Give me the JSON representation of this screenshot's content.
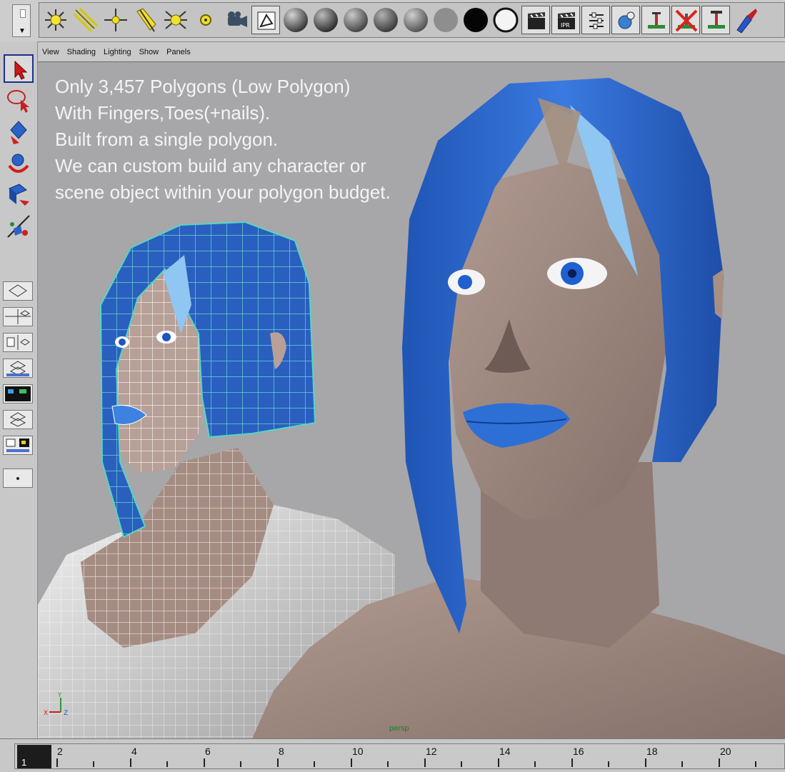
{
  "shelf": {
    "icons": [
      "ambient-light-icon",
      "directional-light-icon",
      "point-light-icon",
      "spot-light-icon",
      "area-light-icon",
      "volume-light-icon",
      "camera-icon",
      "render-layer-icon",
      "shader-sphere-1-icon",
      "shader-sphere-2-icon",
      "shader-sphere-3-icon",
      "shader-sphere-4-icon",
      "shader-sphere-5-icon",
      "gray-swatch-icon",
      "black-swatch-icon",
      "white-circle-icon",
      "clapboard-render-icon",
      "clapboard-ipr-icon",
      "render-settings-icon",
      "hypershade-icon",
      "render-view-icon",
      "delete-render-icon",
      "batch-render-icon",
      "paint-effects-icon"
    ]
  },
  "toolbox": {
    "tools": [
      "select-tool-icon",
      "lasso-tool-icon",
      "move-tool-icon",
      "rotate-tool-icon",
      "scale-tool-icon",
      "manipulator-tool-icon"
    ],
    "layouts": [
      "single-pane-layout-icon",
      "four-pane-layout-icon",
      "two-pane-layout-icon",
      "outliner-layout-icon",
      "hypershade-layout-icon",
      "graph-layout-icon",
      "texture-layout-icon",
      "custom-layout-icon"
    ]
  },
  "panel_menu": {
    "items": [
      "View",
      "Shading",
      "Lighting",
      "Show",
      "Panels"
    ]
  },
  "viewport": {
    "caption": [
      "Only 3,457 Polygons (Low Polygon)",
      "With Fingers,Toes(+nails).",
      "Built from a single polygon.",
      "We can custom build any character or",
      "scene object within your polygon budget."
    ],
    "camera": "persp",
    "axis": {
      "x": "X",
      "y": "Y",
      "z": "Z"
    },
    "colors": {
      "background": "#a7a6a9",
      "hair": "#2f6fd6",
      "skin": "#a0877d",
      "wireframe": "#55d6c2"
    }
  },
  "timeline": {
    "current_frame": "1",
    "labels": [
      "2",
      "4",
      "6",
      "8",
      "10",
      "12",
      "14",
      "16",
      "18",
      "20"
    ]
  }
}
